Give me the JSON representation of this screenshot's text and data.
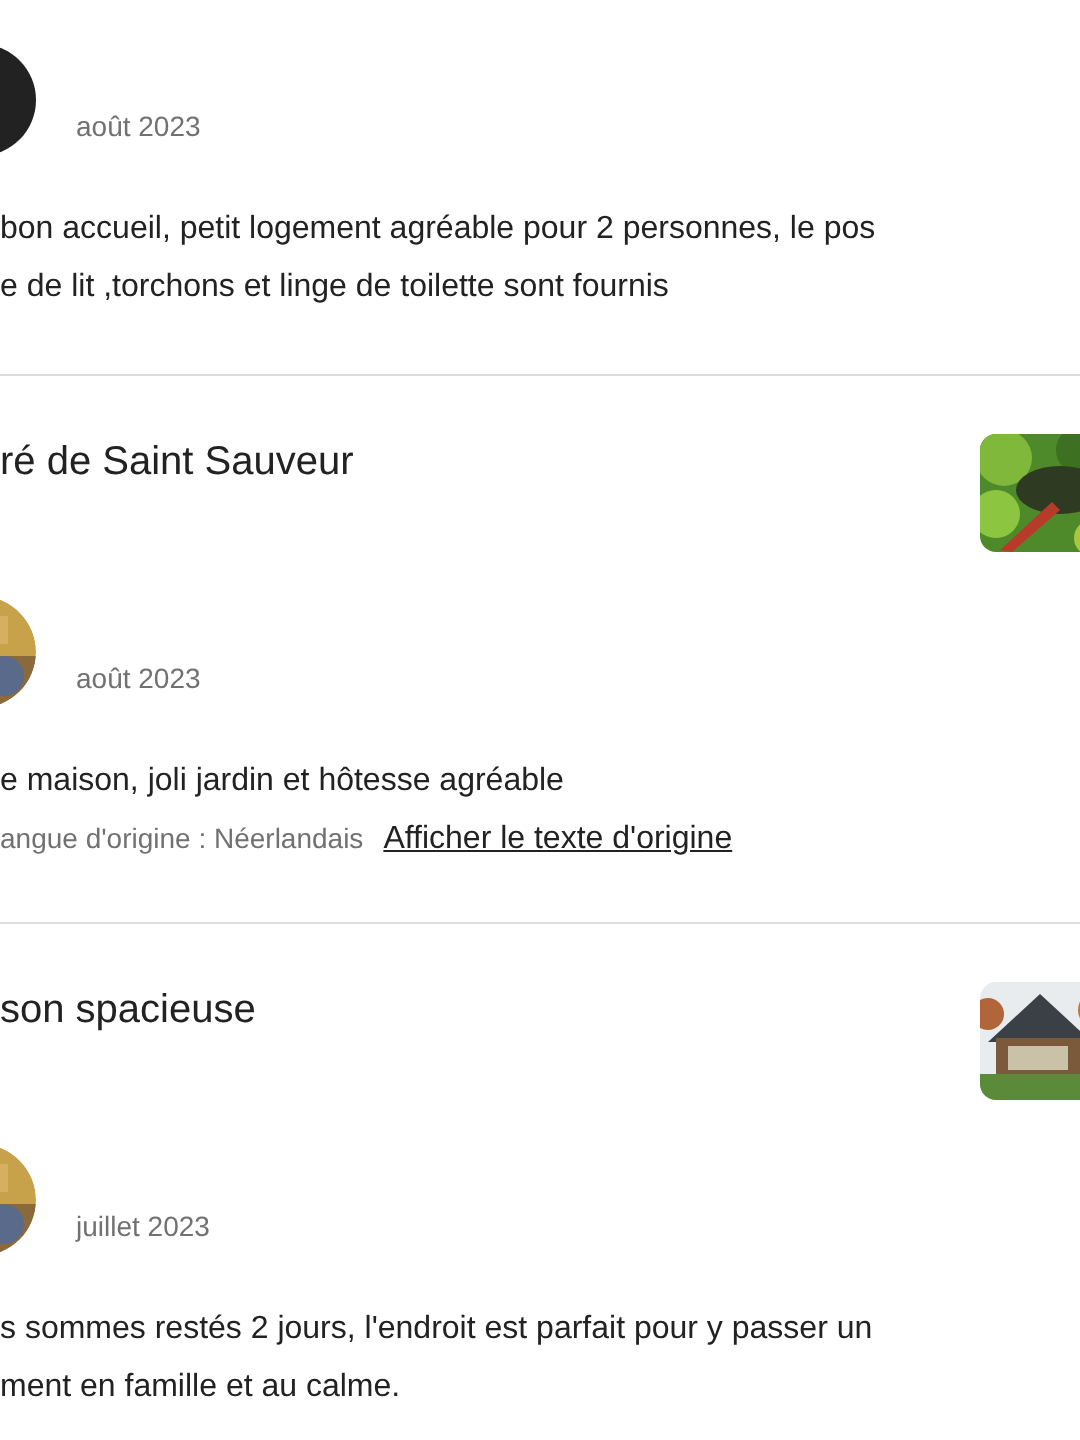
{
  "reviews": [
    {
      "avatar": {
        "kind": "plain"
      },
      "date": "août 2023",
      "lines": [
        "bon accueil, petit logement agréable pour 2 personnes, le pos",
        "e de lit ,torchons et linge de toilette sont fournis"
      ]
    },
    {
      "title": "ré de Saint Sauveur",
      "thumbnail": {
        "kind": "garden"
      },
      "avatar": {
        "kind": "picture"
      },
      "date": "août 2023",
      "lines": [
        "e maison, joli jardin et hôtesse agréable"
      ],
      "translation": {
        "note": "angue d'origine : Néerlandais",
        "link": "Afficher le texte d'origine"
      }
    },
    {
      "title": "son spacieuse",
      "thumbnail": {
        "kind": "house"
      },
      "avatar": {
        "kind": "picture"
      },
      "date": "juillet 2023",
      "lines": [
        "s sommes restés 2 jours, l'endroit est parfait pour y passer un",
        "ment en famille et au calme."
      ]
    }
  ]
}
